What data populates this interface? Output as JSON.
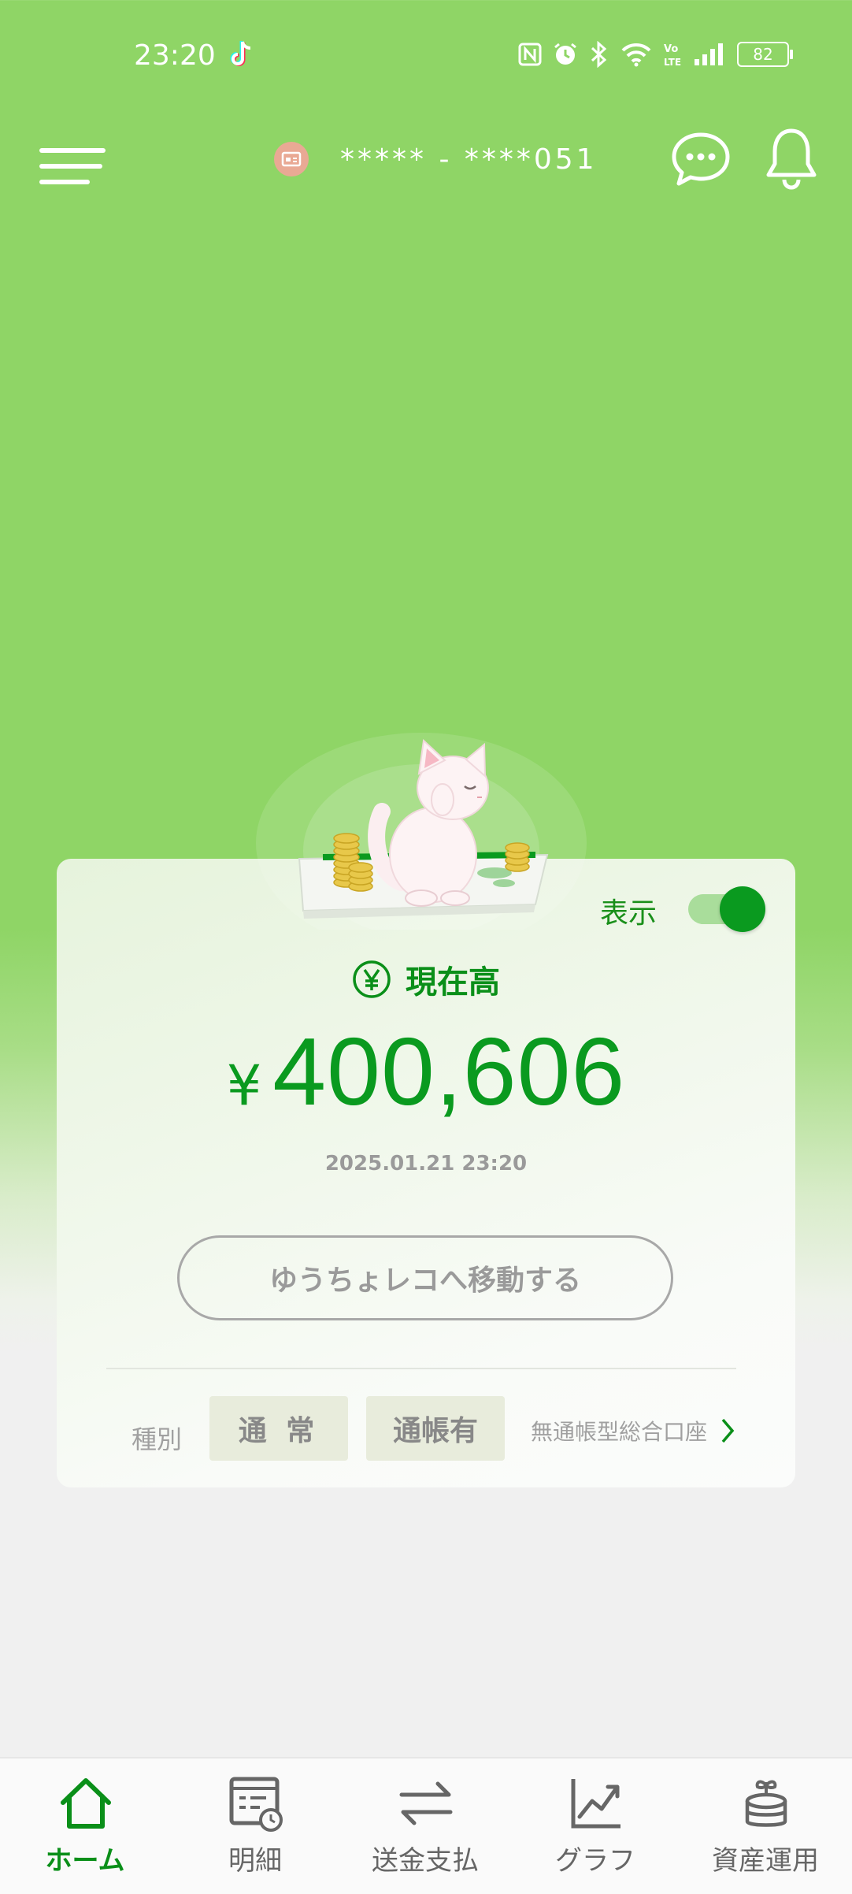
{
  "status_bar": {
    "time": "23:20",
    "battery": "82"
  },
  "header": {
    "account_number": "***** - ****051"
  },
  "card": {
    "toggle_label": "表示",
    "toggle_on": true,
    "balance_title": "現在高",
    "currency_symbol": "¥",
    "balance": "400,606",
    "datetime": "2025.01.21 23:20",
    "move_button": "ゆうちょレコへ移動する",
    "type_label": "種別",
    "type_chips": [
      "通 常",
      "通帳有"
    ],
    "account_type_link": "無通帳型総合口座"
  },
  "bottom_nav": {
    "items": [
      {
        "label": "ホーム",
        "icon": "home-icon",
        "active": true
      },
      {
        "label": "明細",
        "icon": "statement-icon",
        "active": false
      },
      {
        "label": "送金支払",
        "icon": "transfer-icon",
        "active": false
      },
      {
        "label": "グラフ",
        "icon": "graph-icon",
        "active": false
      },
      {
        "label": "資産運用",
        "icon": "asset-management-icon",
        "active": false
      }
    ]
  },
  "colors": {
    "brand_green": "#8fd566",
    "accent_green": "#0a9a1f",
    "background_gray": "#f0f0f0"
  }
}
